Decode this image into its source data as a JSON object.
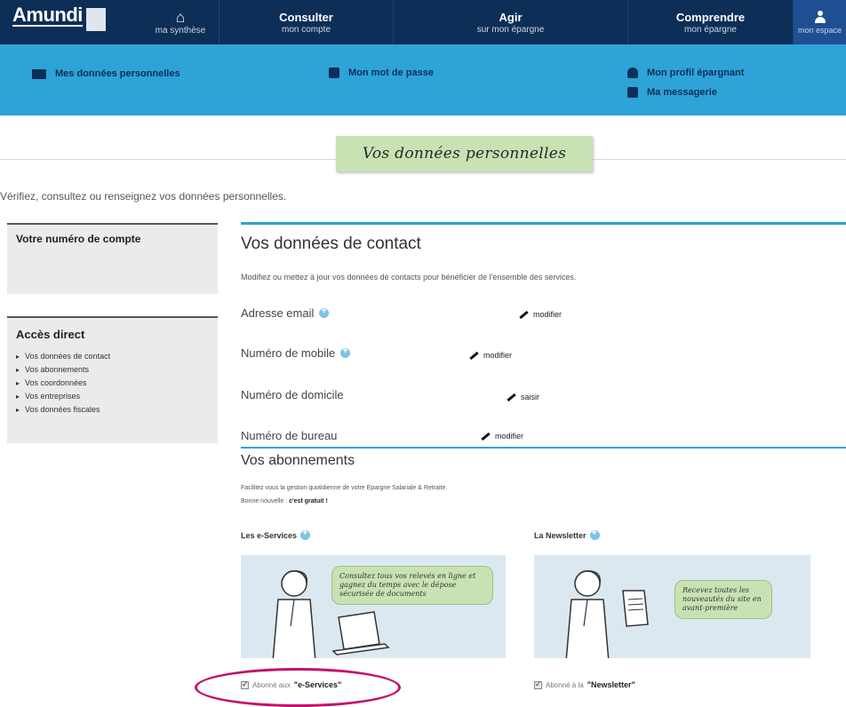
{
  "topnav": {
    "brand": "Amundi",
    "home": {
      "label": "ma synthèse"
    },
    "consulter": {
      "title": "Consulter",
      "subtitle": "mon compte"
    },
    "agir": {
      "title": "Agir",
      "subtitle": "sur mon épargne"
    },
    "comprendre": {
      "title": "Comprendre",
      "subtitle": "mon épargne"
    },
    "espace": {
      "label": "mon espace"
    }
  },
  "subnav": {
    "personal_data": "Mes données personnelles",
    "password": "Mon mot de passe",
    "profile": "Mon profil épargnant",
    "messaging": "Ma messagerie"
  },
  "page_title": "Vos données personnelles",
  "intro": "Vérifiez, consultez ou renseignez vos données personnelles.",
  "sidebar": {
    "account_title": "Votre numéro de compte",
    "direct_title": "Accès direct",
    "links": [
      "Vos données de contact",
      "Vos abonnements",
      "Vos coordonnées",
      "Vos entreprises",
      "Vos données fiscales"
    ]
  },
  "contact": {
    "title": "Vos données de contact",
    "description": "Modifiez ou mettez à jour vos données de contacts pour bénéficier de l'ensemble des services.",
    "rows": [
      {
        "label": "Adresse email",
        "action": "modifier"
      },
      {
        "label": "Numéro de mobile",
        "action": "modifier"
      },
      {
        "label": "Numéro de domicile",
        "action": "saisir"
      },
      {
        "label": "Numéro de bureau",
        "action": "modifier"
      }
    ]
  },
  "subscriptions": {
    "title": "Vos abonnements",
    "desc1": "Facilitez vous la gestion quotidienne de votre Epargne Salariale & Retraite.",
    "desc2_prefix": "Bonne nouvelle :",
    "desc2_bold": "c'est gratuit !",
    "eservices": {
      "title": "Les e-Services",
      "bubble": "Consultez tous vos relevés en ligne et gagnez du temps avec le dépose sécurisée de documents",
      "checkbox_prefix": "Abonné aux",
      "checkbox_name": "\"e-Services\""
    },
    "newsletter": {
      "title": "La Newsletter",
      "bubble": "Recevez toutes les nouveautés du site en avant-première",
      "checkbox_prefix": "Abonné à la",
      "checkbox_name": "\"Newsletter\""
    }
  },
  "colors": {
    "navy": "#0d2e57",
    "sky": "#2ea3d7",
    "green_tag": "#c9e2b3",
    "highlight": "#c2136b"
  }
}
